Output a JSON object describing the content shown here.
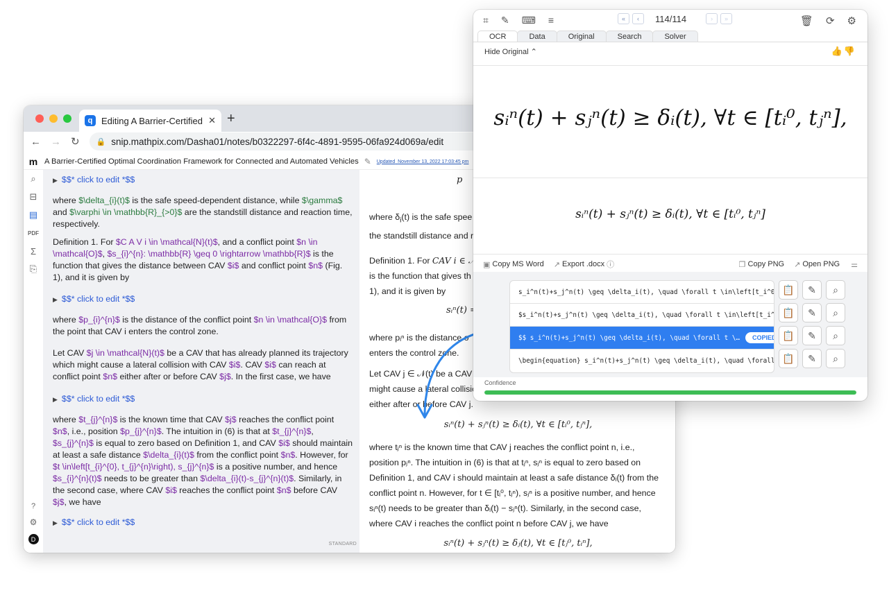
{
  "browser": {
    "tab_title": "Editing A Barrier-Certified Opti",
    "tab_favicon": "q",
    "url": "snip.mathpix.com/Dasha01/notes/b0322297-6f4c-4891-9595-06fa924d069a/edit"
  },
  "app": {
    "logo": "m",
    "doc_title": "A Barrier-Certified Optimal Coordination Framework for Connected and Automated Vehicles",
    "updated_label": "Updated",
    "updated_date": "November 13, 2022 17:03:45 pm",
    "avatar_letter": "D",
    "status_mode": "STANDARD"
  },
  "editor": {
    "math_block_label": "$$* click to edit *$$",
    "p1": {
      "a": "where ",
      "b": "$\\delta_{i}(t)$",
      "c": " is the safe speed-dependent distance, while ",
      "d": "$\\gamma$",
      "e": " and ",
      "f": "$\\varphi \\in \\mathbb{R}_{>0}$",
      "g": " are the standstill distance and reaction time, respectively."
    },
    "p2": {
      "a": "Definition 1. For ",
      "b": "$C A V i \\in \\mathcal{N}(t)$",
      "c": ", and a conflict point ",
      "d": "$n \\in \\mathcal{O}$",
      "e": ", ",
      "f": "$s_{i}^{n}: \\mathbb{R} \\geq 0 \\rightarrow \\mathbb{R}$",
      "g": " is the function that gives the distance between CAV ",
      "h": "$i$",
      "i": " and conflict point ",
      "j": "$n$",
      "k": " (Fig. 1), and it is given by"
    },
    "p3": {
      "a": "where ",
      "b": "$p_{i}^{n}$",
      "c": " is the distance of the conflict point ",
      "d": "$n \\in \\mathcal{O}$",
      "e": " from the point that CAV i enters the control zone."
    },
    "p4": {
      "a": "Let CAV ",
      "b": "$j \\in \\mathcal{N}(t)$",
      "c": " be a CAV that has already planned its trajectory which might cause a lateral collision with CAV ",
      "d": "$i$",
      "e": ". CAV ",
      "f": "$i$",
      "g": " can reach at conflict point ",
      "h": "$n$",
      "i": " either after or before CAV ",
      "j": "$j$",
      "k": ". In the first case, we have"
    },
    "p5": {
      "a": "where ",
      "b": "$t_{j}^{n}$",
      "c": " is the known time that CAV ",
      "d": "$j$",
      "e": " reaches the conflict point ",
      "f": "$n$",
      "g": ", i.e., position ",
      "h": "$p_{j}^{n}$",
      "i": ". The intuition in (6) is that at ",
      "j": "$t_{j}^{n}$",
      "k": ", ",
      "l": "$s_{j}^{n}$",
      "m": " is equal to zero based on Definition 1, and CAV ",
      "n": "$i$",
      "o": " should maintain at least a safe distance ",
      "p": "$\\delta_{i}(t)$",
      "q": " from the conflict point ",
      "r": "$n$",
      "s": ". However, for ",
      "t": "$t \\in\\left[t_{i}^{0}, t_{j}^{n}\\right), s_{j}^{n}$",
      "u": " is a positive number, and hence ",
      "v": "$s_{i}^{n}(t)$",
      "w": " needs to be greater than ",
      "x": "$\\delta_{i}(t)-s_{j}^{n}(t)$",
      "y": ". Similarly, in the second case, where CAV ",
      "z": "$i$",
      "aa": " reaches the conflict point ",
      "ab": "$n$",
      "ac": " before CAV ",
      "ad": "$j$",
      "ae": ", we have"
    }
  },
  "preview": {
    "top_eq": "p",
    "p1": "where δ",
    "p1b": "(t) is the safe spee",
    "p1c": "the standstill distance and r",
    "p2": "Definition 1. For ",
    "p2b": "CAV i ∈ 𝒩",
    "p2c": "is the function that gives th",
    "p2d": "1), and it is given by",
    "eq1": "sᵢⁿ(t) =",
    "p3": "where pᵢⁿ is the distance o",
    "p3b": "enters the control zone.",
    "p4": "Let CAV j ∈ 𝒩(t) be a CAV",
    "p4b": "might cause a lateral collisio",
    "p4c": "either after or before CAV j.",
    "eq2": "sᵢⁿ(t) + sⱼⁿ(t) ≥ δᵢ(t),    ∀t ∈ [tᵢ⁰, tⱼⁿ],",
    "p5_1": "where tⱼⁿ is the known time that CAV j reaches the conflict point n, i.e.,",
    "p5_2": "position pⱼⁿ. The intuition in (6) is that at tⱼⁿ, sⱼⁿ is equal to zero based on",
    "p5_3": "Definition 1, and CAV i should maintain at least a safe distance δᵢ(t) from the",
    "p5_4": "conflict point n. However, for t ∈ [tᵢ⁰, tⱼⁿ), sⱼⁿ is a positive number, and hence",
    "p5_5": "sᵢⁿ(t) needs to be greater than δᵢ(t) − sⱼⁿ(t). Similarly, in the second case,",
    "p5_6": "where CAV i reaches the conflict point n before CAV j, we have",
    "eq3": "sᵢⁿ(t) + sⱼⁿ(t) ≥ δⱼ(t),    ∀t ∈ [tⱼ⁰, tᵢⁿ],"
  },
  "snip": {
    "page_count": "114/114",
    "tabs": [
      "OCR",
      "Data",
      "Original",
      "Search",
      "Solver"
    ],
    "hide_original": "Hide Original",
    "big_eq": "sᵢⁿ(t) + sⱼⁿ(t) ≥ δᵢ(t),    ∀t ∈ [tᵢ⁰, tⱼⁿ],",
    "med_eq": "sᵢⁿ(t) + sⱼⁿ(t) ≥ δᵢ(t),    ∀t ∈ [tᵢ⁰, tⱼⁿ]",
    "copy_ms_word": "Copy MS Word",
    "export_docx": "Export .docx",
    "copy_png": "Copy PNG",
    "open_png": "Open PNG",
    "results": [
      "s_i^n(t)+s_j^n(t) \\geq \\delta_i(t), \\quad \\forall t \\in\\left[t_i^0,…",
      "$s_i^n(t)+s_j^n(t) \\geq \\delta_i(t), \\quad \\forall t \\in\\left[t_i^…",
      "$$ s_i^n(t)+s_j^n(t) \\geq \\delta_i(t), \\quad \\forall t \\…",
      "\\begin{equation} s_i^n(t)+s_j^n(t) \\geq \\delta_i(t), \\quad \\forall t…"
    ],
    "copied_label": "COPIED",
    "confidence_label": "Confidence",
    "confidence": 1.0
  },
  "colors": {
    "accent": "#2f7ef0",
    "confidence": "#3dbd55",
    "latex_green": "#2a7a3e",
    "latex_purple": "#7b2ba5"
  }
}
